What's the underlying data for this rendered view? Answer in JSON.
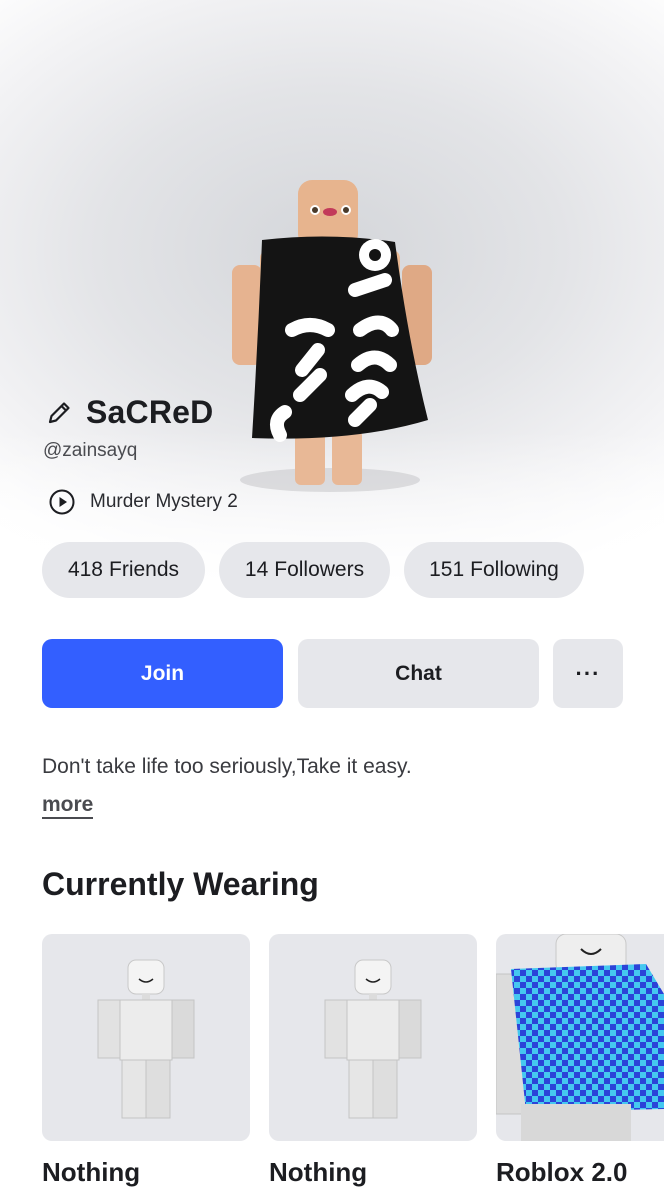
{
  "profile": {
    "display_name": "SaCReD",
    "username": "@zainsayq",
    "current_game": "Murder Mystery 2",
    "about": "Don't take life too seriously,Take it easy.",
    "more_label": "more"
  },
  "stats": [
    {
      "count": "418",
      "label": "Friends"
    },
    {
      "count": "14",
      "label": "Followers"
    },
    {
      "count": "151",
      "label": "Following"
    }
  ],
  "actions": {
    "join_label": "Join",
    "chat_label": "Chat",
    "more_label": "···"
  },
  "wearing": {
    "title": "Currently Wearing",
    "items": [
      {
        "name": "Nothing"
      },
      {
        "name": "Nothing"
      },
      {
        "name": "Roblox 2.0"
      }
    ]
  },
  "colors": {
    "accent": "#335fff",
    "pill_bg": "#e6e7eb",
    "text": "#1c1d21"
  },
  "icons": {
    "edit": "pencil-icon",
    "playing": "play-circle-icon",
    "more": "more-dots-icon"
  }
}
